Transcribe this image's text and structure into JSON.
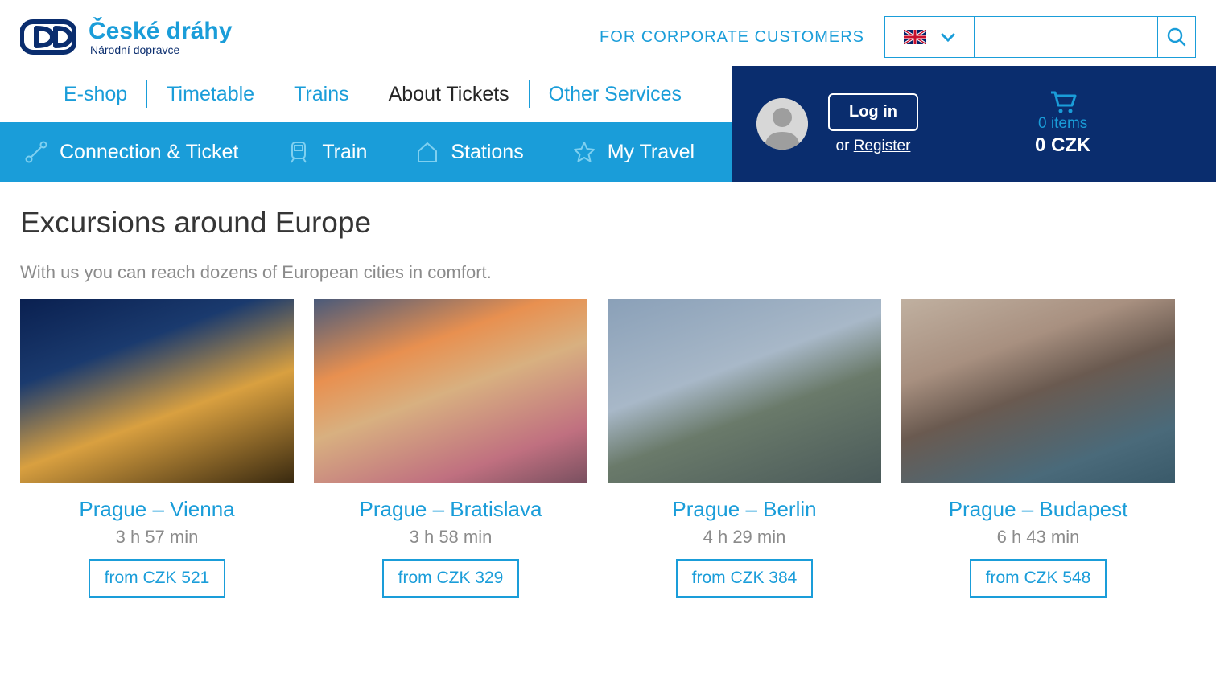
{
  "brand": {
    "name": "České dráhy",
    "tagline": "Národní dopravce"
  },
  "topbar": {
    "corporate_link": "FOR CORPORATE CUSTOMERS",
    "lang_flag": "gb"
  },
  "nav": {
    "items": [
      {
        "label": "E-shop",
        "active": false
      },
      {
        "label": "Timetable",
        "active": false
      },
      {
        "label": "Trains",
        "active": false
      },
      {
        "label": "About Tickets",
        "active": true
      },
      {
        "label": "Other Services",
        "active": false
      }
    ]
  },
  "account": {
    "login_label": "Log in",
    "or_text": "or ",
    "register_label": "Register",
    "cart_items": "0 items",
    "cart_total": "0 CZK"
  },
  "subnav": {
    "items": [
      {
        "label": "Connection & Ticket",
        "icon": "route-icon"
      },
      {
        "label": "Train",
        "icon": "train-icon"
      },
      {
        "label": "Stations",
        "icon": "home-icon"
      },
      {
        "label": "My Travel",
        "icon": "star-icon"
      }
    ]
  },
  "page": {
    "title": "Excursions around Europe",
    "subtitle": "With us you can reach dozens of European cities in comfort."
  },
  "excursions": [
    {
      "route": "Prague – Vienna",
      "duration": "3 h 57 min",
      "price": "from CZK 521"
    },
    {
      "route": "Prague – Bratislava",
      "duration": "3 h 58 min",
      "price": "from CZK 329"
    },
    {
      "route": "Prague – Berlin",
      "duration": "4 h 29 min",
      "price": "from CZK 384"
    },
    {
      "route": "Prague – Budapest",
      "duration": "6 h 43 min",
      "price": "from CZK 548"
    }
  ]
}
